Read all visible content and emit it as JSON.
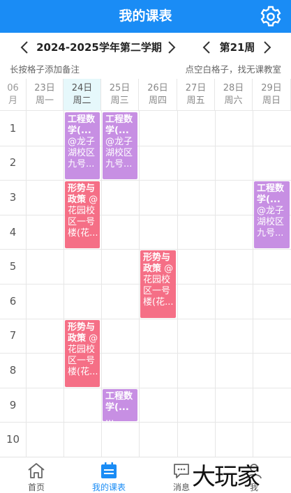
{
  "header": {
    "title": "我的课表",
    "settings_icon": "gear-icon"
  },
  "term": {
    "label": "2024-2025学年第二学期",
    "week": "第21周"
  },
  "hints": {
    "left": "长按格子添加备注",
    "right": "点空白格子，找无课教室"
  },
  "month": {
    "num": "06",
    "unit": "月"
  },
  "days": [
    {
      "date": "23日",
      "weekday": "周一"
    },
    {
      "date": "24日",
      "weekday": "周二",
      "today": true
    },
    {
      "date": "25日",
      "weekday": "周三"
    },
    {
      "date": "26日",
      "weekday": "周四"
    },
    {
      "date": "27日",
      "weekday": "周五"
    },
    {
      "date": "28日",
      "weekday": "周六"
    },
    {
      "date": "29日",
      "weekday": "周日"
    }
  ],
  "periods": [
    "1",
    "2",
    "3",
    "4",
    "5",
    "6",
    "7",
    "8",
    "9",
    "10"
  ],
  "colors": {
    "accent": "#1a8cf5",
    "purple": "#c78fe3",
    "red": "#f56f86",
    "today_bg": "#e6f8fb"
  },
  "courses": [
    {
      "day": 1,
      "start": 1,
      "span": 2,
      "color": "purple",
      "name": "工程数学(...",
      "place": "@龙子湖校区九号..."
    },
    {
      "day": 2,
      "start": 1,
      "span": 2,
      "color": "purple",
      "name": "工程数学(...",
      "place": "@龙子湖校区九号..."
    },
    {
      "day": 1,
      "start": 3,
      "span": 2,
      "color": "red",
      "name": "形势与政策",
      "place": "@花园校区一号楼(花..."
    },
    {
      "day": 6,
      "start": 3,
      "span": 2,
      "color": "purple",
      "name": "工程数学(...",
      "place": "@龙子湖校区九号..."
    },
    {
      "day": 3,
      "start": 5,
      "span": 2,
      "color": "red",
      "name": "形势与政策",
      "place": "@花园校区一号楼(花..."
    },
    {
      "day": 1,
      "start": 7,
      "span": 2,
      "color": "red",
      "name": "形势与政策",
      "place": "@花园校区一号楼(花..."
    },
    {
      "day": 2,
      "start": 9,
      "span": 1,
      "color": "purple",
      "name": "工程数学(...",
      "place": "..."
    }
  ],
  "nav": [
    {
      "label": "首页",
      "icon": "home-icon"
    },
    {
      "label": "我的课表",
      "icon": "calendar-icon",
      "active": true
    },
    {
      "label": "消息",
      "icon": "message-icon"
    },
    {
      "label": "我",
      "icon": "user-icon"
    }
  ],
  "watermark": "大玩家"
}
